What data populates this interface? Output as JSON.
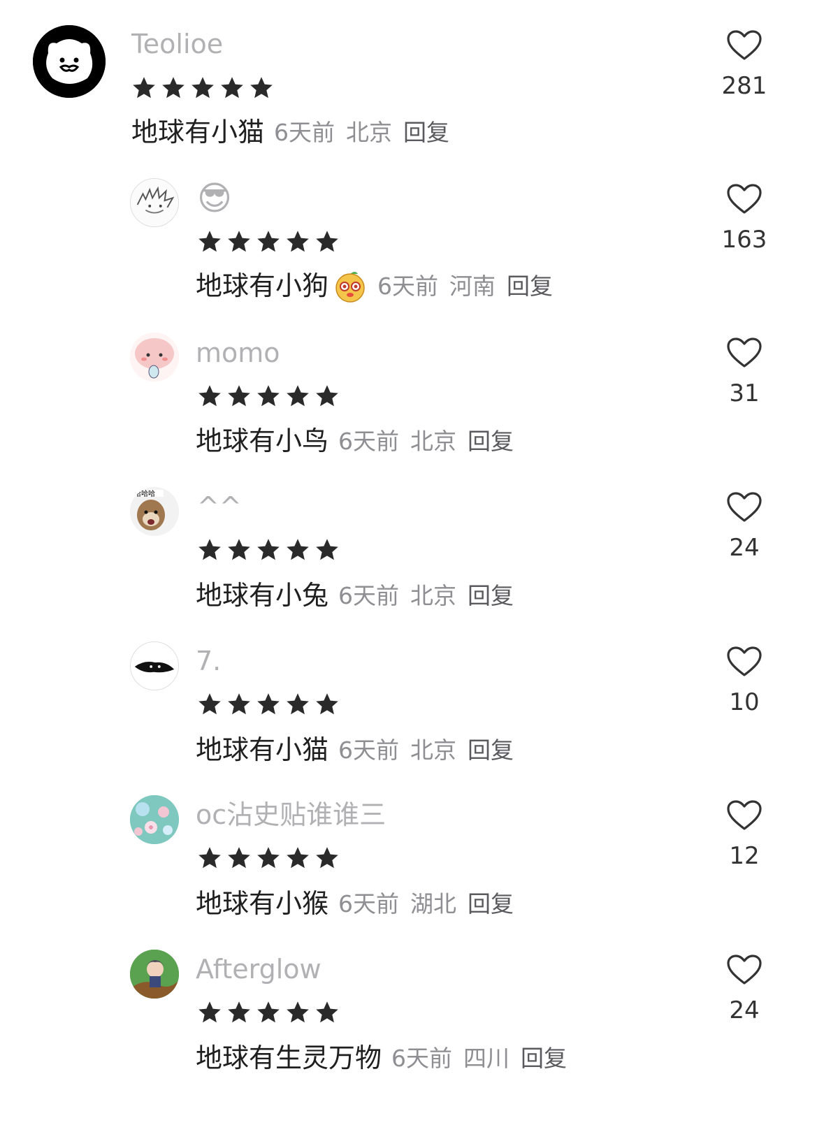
{
  "comments": [
    {
      "username": "Teolioe",
      "rating": 5,
      "text": "地球有小猫",
      "time": "6天前",
      "location": "北京",
      "reply_label": "回复",
      "likes": "281",
      "avatar": "white-cat-face-on-black"
    },
    {
      "username": "😎",
      "rating": 5,
      "text": "地球有小狗",
      "time": "6天前",
      "location": "河南",
      "reply_label": "回复",
      "likes": "163",
      "avatar": "sketch-hair-face",
      "inline_emoji": "peach-face-emoji"
    },
    {
      "username": "momo",
      "rating": 5,
      "text": "地球有小鸟",
      "time": "6天前",
      "location": "北京",
      "reply_label": "回复",
      "likes": "31",
      "avatar": "pink-blob-character"
    },
    {
      "username": "^^",
      "rating": 5,
      "text": "地球有小兔",
      "time": "6天前",
      "location": "北京",
      "reply_label": "回复",
      "likes": "24",
      "avatar": "laughing-dog-meme"
    },
    {
      "username": "7.",
      "rating": 5,
      "text": "地球有小猫",
      "time": "6天前",
      "location": "北京",
      "reply_label": "回复",
      "likes": "10",
      "avatar": "black-cat-peeking"
    },
    {
      "username": "oc沾史贴谁谁三",
      "rating": 5,
      "text": "地球有小猴",
      "time": "6天前",
      "location": "湖北",
      "reply_label": "回复",
      "likes": "12",
      "avatar": "floral-teal-pattern"
    },
    {
      "username": "Afterglow",
      "rating": 5,
      "text": "地球有生灵万物",
      "time": "6天前",
      "location": "四川",
      "reply_label": "回复",
      "likes": "24",
      "avatar": "anime-character-in-tree"
    }
  ],
  "colors": {
    "username": "#b1b1b4",
    "text": "#1f1f1f",
    "meta": "#8e8e93",
    "star": "#2a2a2a",
    "heart": "#333333"
  }
}
